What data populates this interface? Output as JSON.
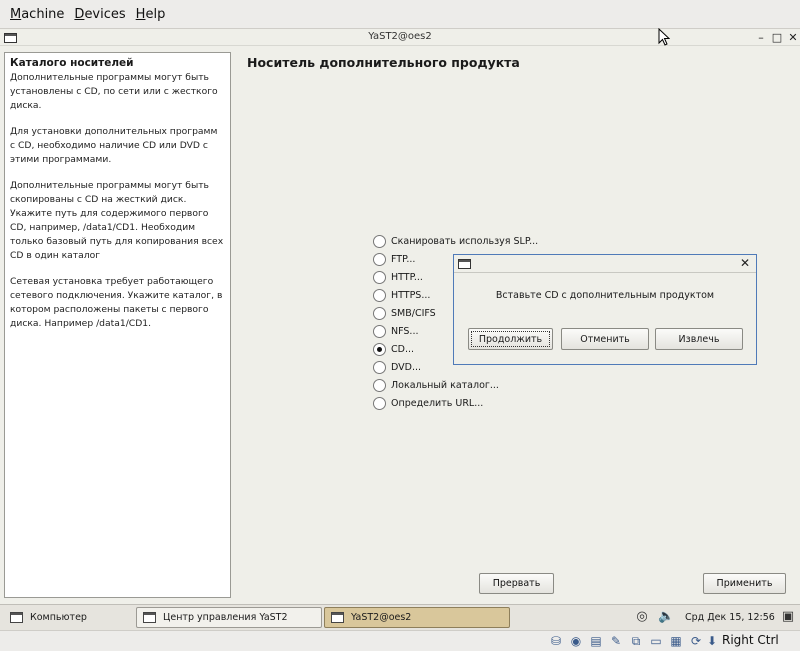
{
  "host": {
    "menu": [
      "Machine",
      "Devices",
      "Help"
    ],
    "status": {
      "host_key": "Right Ctrl"
    }
  },
  "window": {
    "title": "YaST2@oes2",
    "controls": {
      "minimize": "–",
      "maximize": "□",
      "close": "✕"
    }
  },
  "help": {
    "title": "Каталого носителей",
    "paragraphs": [
      "Дополнительные программы могут быть установлены с CD, по сети или с жесткого диска.",
      "Для установки дополнительных программ с CD, необходимо наличие CD или DVD с этими программами.",
      "Дополнительные программы могут быть скопированы с CD на жесткий диск. Укажите путь для содержимого первого CD, например, /data1/CD1. Необходим только базовый путь для копирования всех CD в один каталог",
      "Сетевая установка требует работающего сетевого подключения. Укажите каталог, в котором расположены пакеты с первого диска. Например /data1/CD1."
    ]
  },
  "main": {
    "heading": "Носитель дополнительного продукта",
    "options": [
      {
        "label": "Сканировать используя SLP...",
        "checked": false
      },
      {
        "label": "FTP...",
        "checked": false
      },
      {
        "label": "HTTP...",
        "checked": false
      },
      {
        "label": "HTTPS...",
        "checked": false
      },
      {
        "label": "SMB/CIFS",
        "checked": false
      },
      {
        "label": "NFS...",
        "checked": false
      },
      {
        "label": "CD...",
        "checked": true
      },
      {
        "label": "DVD...",
        "checked": false
      },
      {
        "label": "Локальный каталог...",
        "checked": false
      },
      {
        "label": "Определить URL...",
        "checked": false
      }
    ],
    "abort_label": "Прервать",
    "accept_label": "Применить"
  },
  "dialog": {
    "message": "Вставьте CD с дополнительным продуктом",
    "continue_label": "Продолжить",
    "cancel_label": "Отменить",
    "eject_label": "Извлечь",
    "close": "✕"
  },
  "taskbar": {
    "computer_label": "Компьютер",
    "tasks": [
      "Центр управления YaST2",
      "YaST2@oes2"
    ],
    "clock": "Срд Дек 15, 12:56"
  }
}
